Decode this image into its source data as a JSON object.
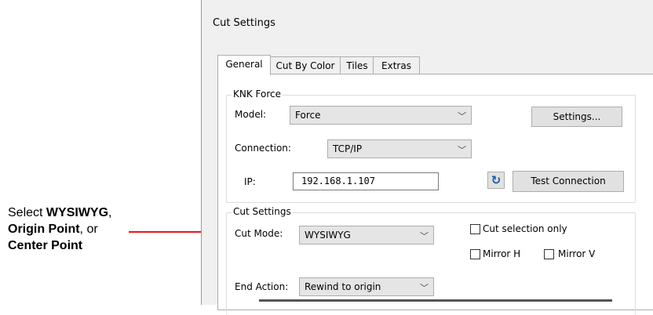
{
  "annotation": {
    "line1_prefix": "Select ",
    "line1_bold": "WYSIWYG",
    "line1_suffix": ",",
    "line2_bold": "Origin Point",
    "line2_suffix": ", or",
    "line3_bold": "Center Point",
    "arrow_color": "#e8141b"
  },
  "window": {
    "title": "Cut Settings"
  },
  "tabs": [
    {
      "label": "General",
      "active": true
    },
    {
      "label": "Cut By Color",
      "active": false
    },
    {
      "label": "Tiles",
      "active": false
    },
    {
      "label": "Extras",
      "active": false
    }
  ],
  "knk_group": {
    "title": "KNK Force",
    "model_label": "Model:",
    "model_value": "Force",
    "settings_button": "Settings...",
    "connection_label": "Connection:",
    "connection_value": "TCP/IP",
    "ip_label": "IP:",
    "ip_value": "192.168.1.107",
    "refresh_icon": "refresh-icon",
    "test_button": "Test Connection"
  },
  "cut_group": {
    "title": "Cut Settings",
    "cut_mode_label": "Cut Mode:",
    "cut_mode_value": "WYSIWYG",
    "cut_selection_label": "Cut selection only",
    "mirror_h_label": "Mirror H",
    "mirror_v_label": "Mirror V",
    "end_action_label": "End Action:",
    "end_action_value": "Rewind to origin"
  },
  "colors": {
    "refresh_icon": "#1e5aa8"
  }
}
